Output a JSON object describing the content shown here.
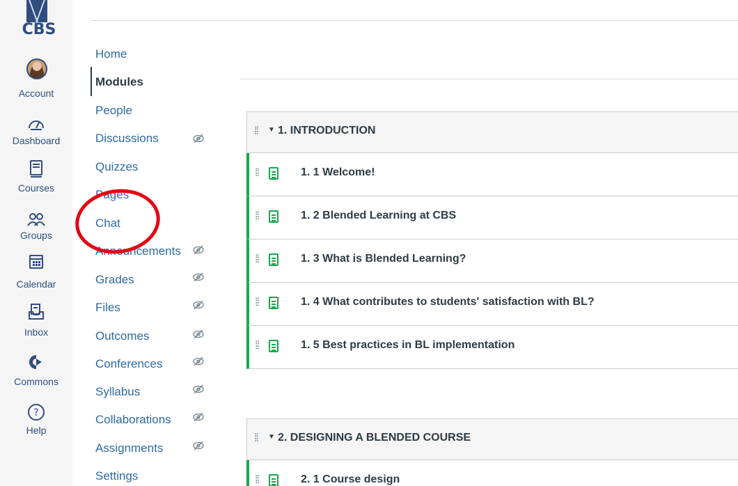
{
  "global_nav": {
    "logo_text": "CBS",
    "items": [
      {
        "label": "Account",
        "icon": "avatar"
      },
      {
        "label": "Dashboard",
        "icon": "dashboard-icon"
      },
      {
        "label": "Courses",
        "icon": "courses-icon"
      },
      {
        "label": "Groups",
        "icon": "groups-icon"
      },
      {
        "label": "Calendar",
        "icon": "calendar-icon"
      },
      {
        "label": "Inbox",
        "icon": "inbox-icon"
      },
      {
        "label": "Commons",
        "icon": "commons-icon"
      },
      {
        "label": "Help",
        "icon": "help-icon"
      }
    ]
  },
  "course_nav": {
    "items": [
      {
        "label": "Home",
        "hidden": false
      },
      {
        "label": "Modules",
        "hidden": false,
        "active": true
      },
      {
        "label": "People",
        "hidden": false
      },
      {
        "label": "Discussions",
        "hidden": true
      },
      {
        "label": "Quizzes",
        "hidden": false
      },
      {
        "label": "Pages",
        "hidden": false
      },
      {
        "label": "Chat",
        "hidden": false
      },
      {
        "label": "Announcements",
        "hidden": true
      },
      {
        "label": "Grades",
        "hidden": true
      },
      {
        "label": "Files",
        "hidden": true
      },
      {
        "label": "Outcomes",
        "hidden": true
      },
      {
        "label": "Conferences",
        "hidden": true
      },
      {
        "label": "Syllabus",
        "hidden": true
      },
      {
        "label": "Collaborations",
        "hidden": true
      },
      {
        "label": "Assignments",
        "hidden": true
      },
      {
        "label": "Settings",
        "hidden": false
      }
    ]
  },
  "modules": [
    {
      "title": "1. INTRODUCTION",
      "items": [
        "1. 1 Welcome!",
        "1. 2 Blended Learning at CBS",
        "1. 3 What is Blended Learning?",
        "1. 4 What contributes to students' satisfaction with BL?",
        "1. 5 Best practices in BL implementation"
      ]
    },
    {
      "title": "2. DESIGNING A BLENDED COURSE",
      "items": [
        "2. 1 Course design"
      ]
    }
  ],
  "colors": {
    "nav_blue": "#2f4d7e",
    "link_blue": "#2d6aa3",
    "item_green": "#15a84a",
    "annotation_red": "#e30613"
  }
}
